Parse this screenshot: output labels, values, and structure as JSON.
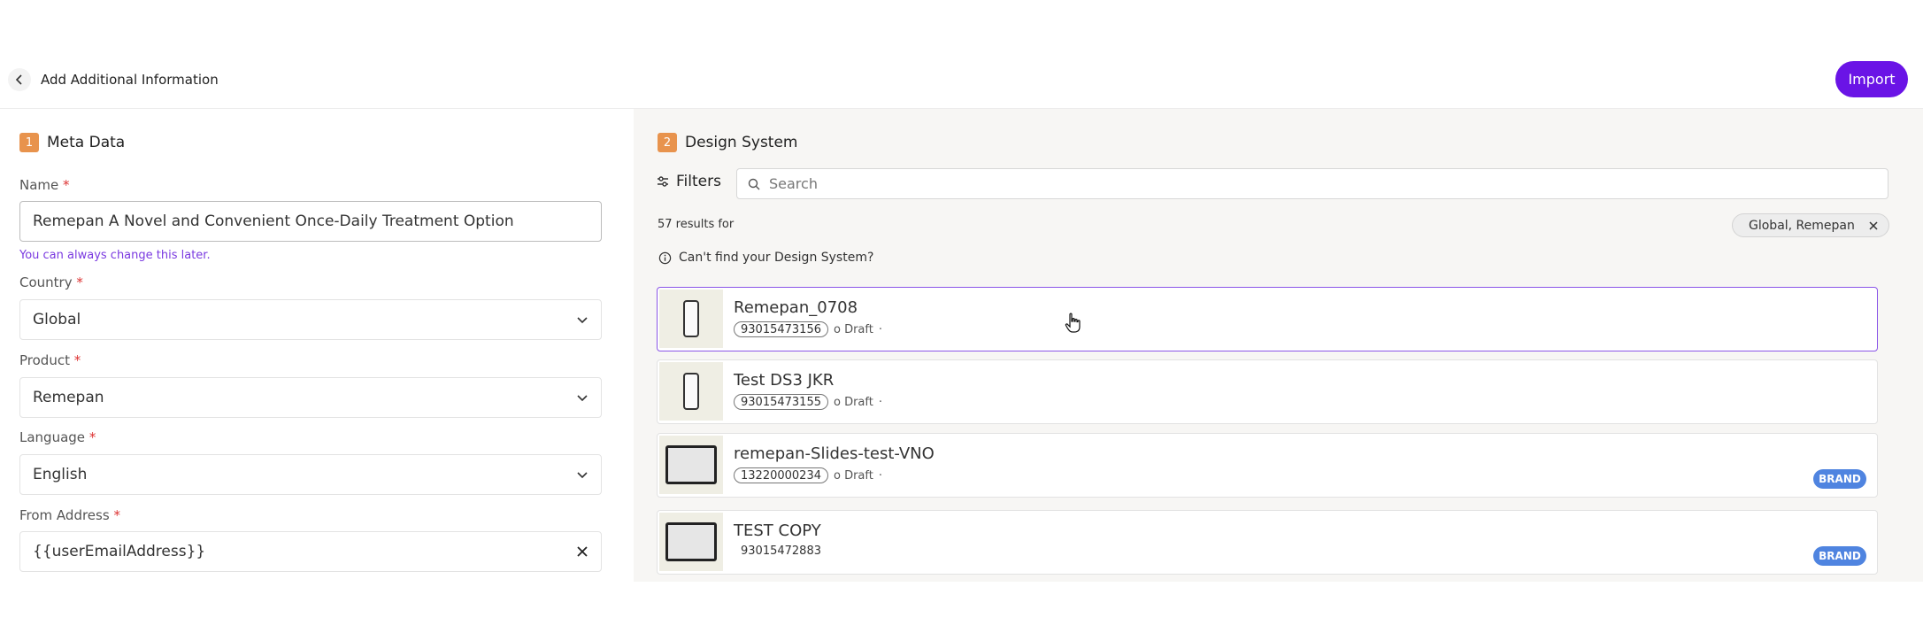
{
  "header": {
    "title": "Add Additional Information",
    "import_label": "Import"
  },
  "meta": {
    "number": "1",
    "title": "Meta Data",
    "name_label": "Name",
    "name_value": "Remepan A Novel and Convenient Once-Daily Treatment Option",
    "name_helper": "You can always change this later.",
    "country_label": "Country",
    "country_value": "Global",
    "product_label": "Product",
    "product_value": "Remepan",
    "language_label": "Language",
    "language_value": "English",
    "from_label": "From Address",
    "from_value": "{{userEmailAddress}}",
    "required_mark": "*"
  },
  "design": {
    "number": "2",
    "title": "Design System",
    "filters_label": "Filters",
    "search_placeholder": "Search",
    "results_text": "57 results for",
    "chip_label": "Global, Remepan",
    "cant_find": "Can't find your Design System?",
    "cards": [
      {
        "title": "Remepan_0708",
        "id": "93015473156",
        "status": "o Draft",
        "dot": "·",
        "brand": ""
      },
      {
        "title": "Test DS3 JKR",
        "id": "93015473155",
        "status": "o Draft",
        "dot": "·",
        "brand": ""
      },
      {
        "title": "remepan-Slides-test-VNO",
        "id": "13220000234",
        "status": "o Draft",
        "dot": "·",
        "brand": "BRAND"
      },
      {
        "title": "TEST COPY",
        "id": "93015472883",
        "status": "",
        "dot": "",
        "brand": "BRAND"
      }
    ]
  },
  "colors": {
    "accent": "#6a14e6",
    "step": "#e8934d",
    "brand_badge": "#4f84e0",
    "selected_border": "#8b55e8"
  }
}
